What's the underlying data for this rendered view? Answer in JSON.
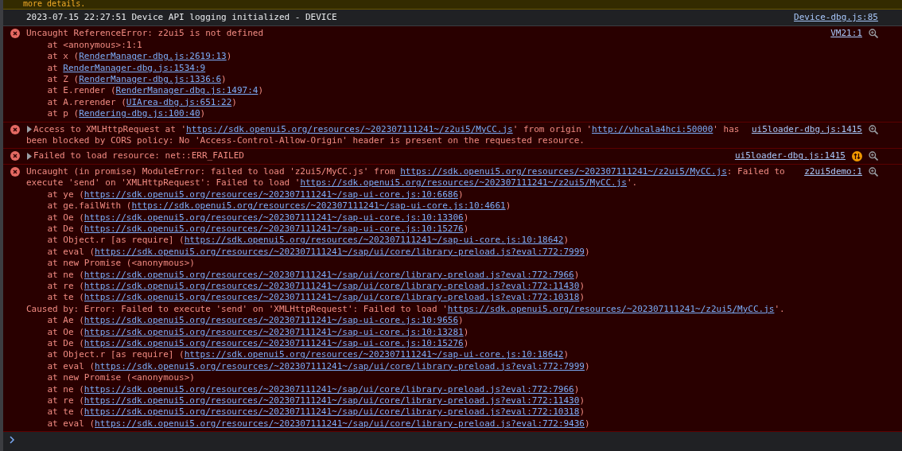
{
  "warning": {
    "text": "more details."
  },
  "messages": [
    {
      "kind": "info",
      "head": [
        {
          "text": "2023-07-15 22:27:51 Device API logging initialized - DEVICE"
        }
      ],
      "source": "Device-dbg.js:85"
    },
    {
      "kind": "error",
      "head": [
        {
          "text": "Uncaught ReferenceError: z2ui5 is not defined"
        }
      ],
      "source": "VM21:1",
      "lines": [
        {
          "kind": "frame",
          "parts": [
            {
              "text": "at <anonymous>:1:1"
            }
          ]
        },
        {
          "kind": "frame",
          "parts": [
            {
              "text": "at x ("
            },
            {
              "link": "RenderManager-dbg.js:2619:13"
            },
            {
              "text": ")"
            }
          ]
        },
        {
          "kind": "frame",
          "parts": [
            {
              "text": "at "
            },
            {
              "link": "RenderManager-dbg.js:1534:9"
            }
          ]
        },
        {
          "kind": "frame",
          "parts": [
            {
              "text": "at Z ("
            },
            {
              "link": "RenderManager-dbg.js:1336:6"
            },
            {
              "text": ")"
            }
          ]
        },
        {
          "kind": "frame",
          "parts": [
            {
              "text": "at E.render ("
            },
            {
              "link": "RenderManager-dbg.js:1497:4"
            },
            {
              "text": ")"
            }
          ]
        },
        {
          "kind": "frame",
          "parts": [
            {
              "text": "at A.rerender ("
            },
            {
              "link": "UIArea-dbg.js:651:22"
            },
            {
              "text": ")"
            }
          ]
        },
        {
          "kind": "frame",
          "parts": [
            {
              "text": "at p ("
            },
            {
              "link": "Rendering-dbg.js:100:40"
            },
            {
              "text": ")"
            }
          ]
        }
      ]
    },
    {
      "kind": "error",
      "expanded": false,
      "head": [
        {
          "text": "Access to XMLHttpRequest at '"
        },
        {
          "link": "https://sdk.openui5.org/resources/~202307111241~/z2ui5/MyCC.js"
        },
        {
          "text": "' from origin '"
        },
        {
          "link": "http://vhcala4hci:50000"
        },
        {
          "text": "' has been blocked by CORS policy: No 'Access-Control-Allow-Origin' header is present on the requested resource."
        }
      ],
      "source": "ui5loader-dbg.js:1415"
    },
    {
      "kind": "error",
      "expanded": false,
      "network": true,
      "head": [
        {
          "text": "Failed to load resource: net::ERR_FAILED"
        }
      ],
      "source": "ui5loader-dbg.js:1415"
    },
    {
      "kind": "error",
      "head": [
        {
          "text": "Uncaught (in promise) ModuleError: failed to load 'z2ui5/MyCC.js' from "
        },
        {
          "link": "https://sdk.openui5.org/resources/~202307111241~/z2ui5/MyCC.js"
        },
        {
          "text": ": Failed to execute 'send' on 'XMLHttpRequest': Failed to load '"
        },
        {
          "link": "https://sdk.openui5.org/resources/~202307111241~/z2ui5/MyCC.js"
        },
        {
          "text": "'."
        }
      ],
      "source": "z2ui5demo:1",
      "lines": [
        {
          "kind": "frame",
          "parts": [
            {
              "text": "at ye ("
            },
            {
              "link": "https://sdk.openui5.org/resources/~202307111241~/sap-ui-core.js:10:6686"
            },
            {
              "text": ")"
            }
          ]
        },
        {
          "kind": "frame",
          "parts": [
            {
              "text": "at ge.failWith ("
            },
            {
              "link": "https://sdk.openui5.org/resources/~202307111241~/sap-ui-core.js:10:4661"
            },
            {
              "text": ")"
            }
          ]
        },
        {
          "kind": "frame",
          "parts": [
            {
              "text": "at Oe ("
            },
            {
              "link": "https://sdk.openui5.org/resources/~202307111241~/sap-ui-core.js:10:13306"
            },
            {
              "text": ")"
            }
          ]
        },
        {
          "kind": "frame",
          "parts": [
            {
              "text": "at De ("
            },
            {
              "link": "https://sdk.openui5.org/resources/~202307111241~/sap-ui-core.js:10:15276"
            },
            {
              "text": ")"
            }
          ]
        },
        {
          "kind": "frame",
          "parts": [
            {
              "text": "at Object.r [as require] ("
            },
            {
              "link": "https://sdk.openui5.org/resources/~202307111241~/sap-ui-core.js:10:18642"
            },
            {
              "text": ")"
            }
          ]
        },
        {
          "kind": "frame",
          "parts": [
            {
              "text": "at eval ("
            },
            {
              "link": "https://sdk.openui5.org/resources/~202307111241~/sap/ui/core/library-preload.js?eval:772:7999"
            },
            {
              "text": ")"
            }
          ]
        },
        {
          "kind": "frame",
          "parts": [
            {
              "text": "at new Promise (<anonymous>)"
            }
          ]
        },
        {
          "kind": "frame",
          "parts": [
            {
              "text": "at ne ("
            },
            {
              "link": "https://sdk.openui5.org/resources/~202307111241~/sap/ui/core/library-preload.js?eval:772:7966"
            },
            {
              "text": ")"
            }
          ]
        },
        {
          "kind": "frame",
          "parts": [
            {
              "text": "at re ("
            },
            {
              "link": "https://sdk.openui5.org/resources/~202307111241~/sap/ui/core/library-preload.js?eval:772:11430"
            },
            {
              "text": ")"
            }
          ]
        },
        {
          "kind": "frame",
          "parts": [
            {
              "text": "at te ("
            },
            {
              "link": "https://sdk.openui5.org/resources/~202307111241~/sap/ui/core/library-preload.js?eval:772:10318"
            },
            {
              "text": ")"
            }
          ]
        },
        {
          "kind": "cause",
          "parts": [
            {
              "text": "Caused by: Error: Failed to execute 'send' on 'XMLHttpRequest': Failed to load '"
            },
            {
              "link": "https://sdk.openui5.org/resources/~202307111241~/z2ui5/MyCC.js"
            },
            {
              "text": "'."
            }
          ]
        },
        {
          "kind": "frame",
          "parts": [
            {
              "text": "at Ae ("
            },
            {
              "link": "https://sdk.openui5.org/resources/~202307111241~/sap-ui-core.js:10:9656"
            },
            {
              "text": ")"
            }
          ]
        },
        {
          "kind": "frame",
          "parts": [
            {
              "text": "at Oe ("
            },
            {
              "link": "https://sdk.openui5.org/resources/~202307111241~/sap-ui-core.js:10:13281"
            },
            {
              "text": ")"
            }
          ]
        },
        {
          "kind": "frame",
          "parts": [
            {
              "text": "at De ("
            },
            {
              "link": "https://sdk.openui5.org/resources/~202307111241~/sap-ui-core.js:10:15276"
            },
            {
              "text": ")"
            }
          ]
        },
        {
          "kind": "frame",
          "parts": [
            {
              "text": "at Object.r [as require] ("
            },
            {
              "link": "https://sdk.openui5.org/resources/~202307111241~/sap-ui-core.js:10:18642"
            },
            {
              "text": ")"
            }
          ]
        },
        {
          "kind": "frame",
          "parts": [
            {
              "text": "at eval ("
            },
            {
              "link": "https://sdk.openui5.org/resources/~202307111241~/sap/ui/core/library-preload.js?eval:772:7999"
            },
            {
              "text": ")"
            }
          ]
        },
        {
          "kind": "frame",
          "parts": [
            {
              "text": "at new Promise (<anonymous>)"
            }
          ]
        },
        {
          "kind": "frame",
          "parts": [
            {
              "text": "at ne ("
            },
            {
              "link": "https://sdk.openui5.org/resources/~202307111241~/sap/ui/core/library-preload.js?eval:772:7966"
            },
            {
              "text": ")"
            }
          ]
        },
        {
          "kind": "frame",
          "parts": [
            {
              "text": "at re ("
            },
            {
              "link": "https://sdk.openui5.org/resources/~202307111241~/sap/ui/core/library-preload.js?eval:772:11430"
            },
            {
              "text": ")"
            }
          ]
        },
        {
          "kind": "frame",
          "parts": [
            {
              "text": "at te ("
            },
            {
              "link": "https://sdk.openui5.org/resources/~202307111241~/sap/ui/core/library-preload.js?eval:772:10318"
            },
            {
              "text": ")"
            }
          ]
        },
        {
          "kind": "frame",
          "parts": [
            {
              "text": "at eval ("
            },
            {
              "link": "https://sdk.openui5.org/resources/~202307111241~/sap/ui/core/library-preload.js?eval:772:9436"
            },
            {
              "text": ")"
            }
          ]
        }
      ]
    }
  ]
}
